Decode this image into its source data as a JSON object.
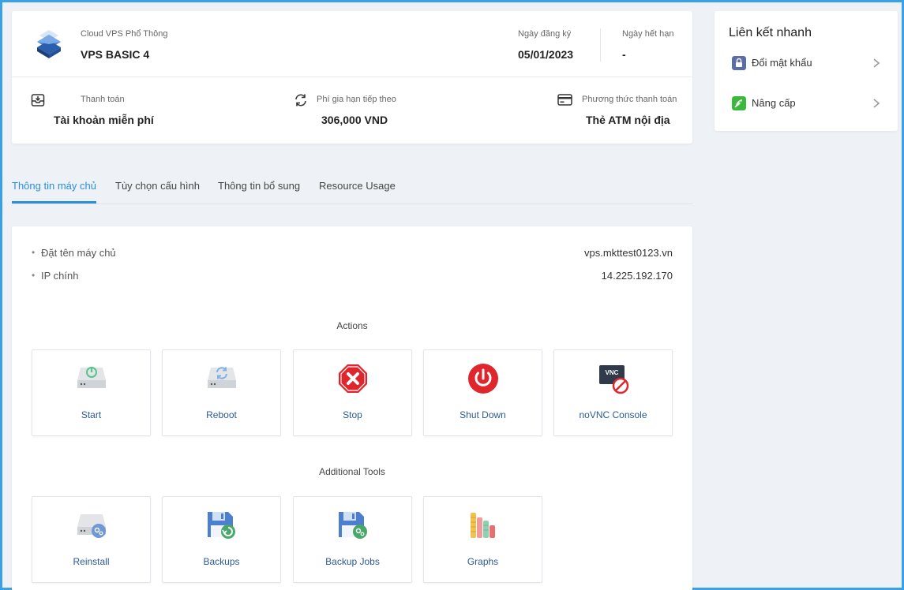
{
  "product": {
    "category": "Cloud VPS Phổ Thông",
    "name": "VPS BASIC 4",
    "registration_label": "Ngày đăng ký",
    "registration_date": "05/01/2023",
    "expiry_label": "Ngày hết hạn",
    "expiry_date": "-"
  },
  "billing": {
    "payment_label": "Thanh toán",
    "payment_value": "Tài khoản miễn phí",
    "renewal_label": "Phí gia hạn tiếp theo",
    "renewal_value": "306,000 VND",
    "method_label": "Phương thức thanh toán",
    "method_value": "Thẻ ATM nội địa"
  },
  "quick_links": {
    "title": "Liên kết nhanh",
    "items": [
      {
        "label": "Đổi mật khẩu",
        "icon": "lock-icon",
        "color": "#5b6ea8"
      },
      {
        "label": "Nâng cấp",
        "icon": "rocket-icon",
        "color": "#3cb93c"
      }
    ]
  },
  "tabs": [
    {
      "label": "Thông tin máy chủ",
      "active": true
    },
    {
      "label": "Tùy chọn cấu hình",
      "active": false
    },
    {
      "label": "Thông tin bổ sung",
      "active": false
    },
    {
      "label": "Resource Usage",
      "active": false
    }
  ],
  "server_info": {
    "hostname_label": "Đặt tên máy chủ",
    "hostname_value": "vps.mkttest0123.vn",
    "ip_label": "IP chính",
    "ip_value": "14.225.192.170"
  },
  "actions": {
    "title": "Actions",
    "items": [
      {
        "label": "Start",
        "icon": "server-power-icon"
      },
      {
        "label": "Reboot",
        "icon": "server-reboot-icon"
      },
      {
        "label": "Stop",
        "icon": "stop-icon"
      },
      {
        "label": "Shut Down",
        "icon": "power-icon"
      },
      {
        "label": "noVNC Console",
        "icon": "vnc-disabled-icon"
      }
    ]
  },
  "tools": {
    "title": "Additional Tools",
    "items": [
      {
        "label": "Reinstall",
        "icon": "server-reinstall-icon"
      },
      {
        "label": "Backups",
        "icon": "backup-icon"
      },
      {
        "label": "Backup Jobs",
        "icon": "backup-jobs-icon"
      },
      {
        "label": "Graphs",
        "icon": "graphs-icon"
      }
    ]
  },
  "colors": {
    "accent": "#2b8fd8",
    "frame": "#3aa0e8",
    "danger": "#e0262d",
    "tile_label": "#2c5a94"
  }
}
